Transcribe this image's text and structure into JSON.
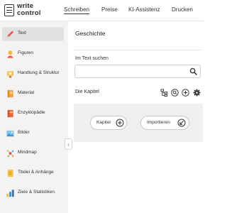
{
  "app": {
    "logo_line1": "write",
    "logo_line2": "control"
  },
  "nav": [
    {
      "label": "Schreiben",
      "active": true
    },
    {
      "label": "Preise"
    },
    {
      "label": "KI-Assistenz"
    },
    {
      "label": "Drucken"
    }
  ],
  "sidebar": {
    "items": [
      {
        "label": "Text",
        "icon": "pencil-icon",
        "active": true
      },
      {
        "label": "Figuren",
        "icon": "person-icon"
      },
      {
        "label": "Handlung & Struktur",
        "icon": "timeline-icon"
      },
      {
        "label": "Material",
        "icon": "notebook-icon"
      },
      {
        "label": "Enzyklopädie",
        "icon": "encyclopedia-icon"
      },
      {
        "label": "Bilder",
        "icon": "image-icon"
      },
      {
        "label": "Mindmap",
        "icon": "mindmap-icon"
      },
      {
        "label": "Titelei & Anhänge",
        "icon": "document-icon"
      },
      {
        "label": "Ziele & Statistiken",
        "icon": "bar-chart-icon"
      }
    ],
    "collapse_glyph": "‹"
  },
  "main": {
    "title": "Geschichte",
    "search": {
      "label": "Im Text suchen",
      "value": "",
      "placeholder": ""
    },
    "chapters": {
      "title": "Die Kapitel",
      "buttons": [
        {
          "label": "Kapitel",
          "icon": "plus-circle-icon"
        },
        {
          "label": "Importieren",
          "icon": "import-arrow-icon"
        }
      ]
    }
  },
  "colors": {
    "accent_red": "#e2574c",
    "sidebar_bg": "#f3f3f3",
    "panel_bg": "#efefef"
  }
}
